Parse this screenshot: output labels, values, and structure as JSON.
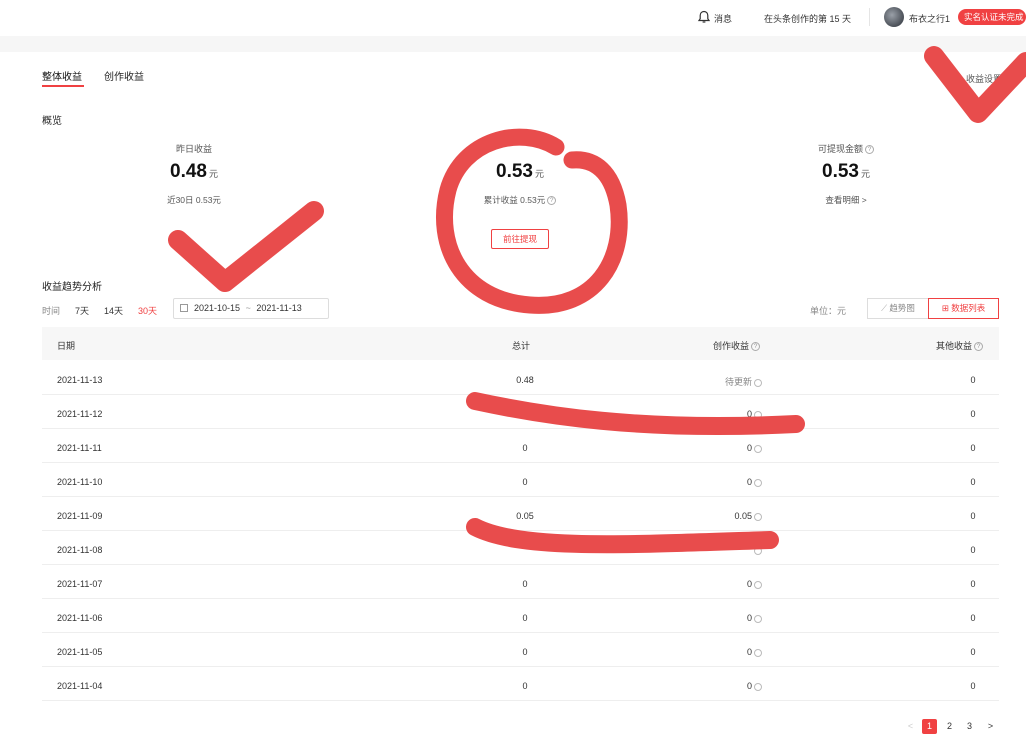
{
  "topbar": {
    "messages": "消息",
    "days": "在头条创作的第 15 天",
    "username": "布衣之行1",
    "verify_badge": "实名认证未完成"
  },
  "tabs": [
    {
      "label": "整体收益",
      "active": true
    },
    {
      "label": "创作收益",
      "active": false
    }
  ],
  "settings_link": "收益设置",
  "overview": {
    "title": "概览",
    "yesterday": {
      "label": "昨日收益",
      "value": "0.48",
      "unit": "元",
      "sub": "近30日 0.53元"
    },
    "total": {
      "value": "0.53",
      "unit": "元",
      "sub": "累计收益 0.53元",
      "button": "前往提现"
    },
    "withdrawable": {
      "label": "可提现金额",
      "value": "0.53",
      "unit": "元",
      "link": "查看明细 >"
    }
  },
  "trend": {
    "title": "收益趋势分析",
    "time_label": "时间",
    "ranges": [
      "7天",
      "14天",
      "30天"
    ],
    "selected_range": "30天",
    "date_start": "2021-10-15",
    "date_sep": "~",
    "date_end": "2021-11-13",
    "unit_label": "单位：元",
    "view_chart": "趋势图",
    "view_table": "数据列表"
  },
  "table": {
    "headers": [
      "日期",
      "总计",
      "创作收益",
      "其他收益"
    ],
    "rows": [
      {
        "date": "2021-11-13",
        "total": "0.48",
        "creation": "待更新",
        "other": "0"
      },
      {
        "date": "2021-11-12",
        "total": "",
        "creation": "0",
        "other": "0"
      },
      {
        "date": "2021-11-11",
        "total": "0",
        "creation": "0",
        "other": "0"
      },
      {
        "date": "2021-11-10",
        "total": "0",
        "creation": "0",
        "other": "0"
      },
      {
        "date": "2021-11-09",
        "total": "0.05",
        "creation": "0.05",
        "other": "0"
      },
      {
        "date": "2021-11-08",
        "total": "",
        "creation": "",
        "other": "0"
      },
      {
        "date": "2021-11-07",
        "total": "0",
        "creation": "0",
        "other": "0"
      },
      {
        "date": "2021-11-06",
        "total": "0",
        "creation": "0",
        "other": "0"
      },
      {
        "date": "2021-11-05",
        "total": "0",
        "creation": "0",
        "other": "0"
      },
      {
        "date": "2021-11-04",
        "total": "0",
        "creation": "0",
        "other": "0"
      }
    ]
  },
  "pagination": {
    "prev": "<",
    "pages": [
      "1",
      "2",
      "3"
    ],
    "current": "1",
    "next": ">"
  },
  "colors": {
    "accent": "#f04142",
    "annotation": "#e84c4c"
  }
}
